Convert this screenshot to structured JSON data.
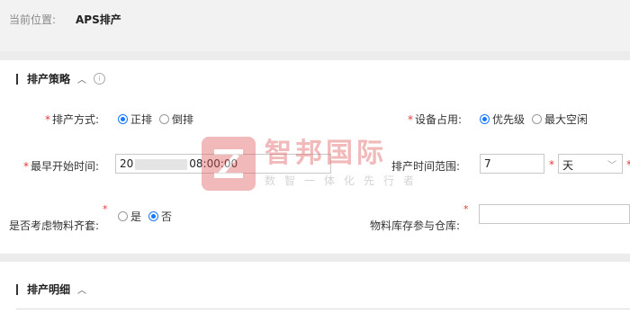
{
  "breadcrumb": {
    "prefix": "当前位置:",
    "current": "APS排产"
  },
  "strategy": {
    "title": "排产策略",
    "method": {
      "label": "排产方式:",
      "options": [
        {
          "label": "正排",
          "selected": true
        },
        {
          "label": "倒排",
          "selected": false
        }
      ]
    },
    "device": {
      "label": "设备占用:",
      "options": [
        {
          "label": "优先级",
          "selected": true
        },
        {
          "label": "最大空闲",
          "selected": false
        }
      ]
    },
    "earliest": {
      "label": "最早开始时间:",
      "value_prefix": "20",
      "value_suffix": "08:00:00"
    },
    "range": {
      "label": "排产时间范围:",
      "value": "7",
      "unit": "天"
    },
    "kitting": {
      "label": "是否考虑物料齐套:",
      "options": [
        {
          "label": "是",
          "selected": false
        },
        {
          "label": "否",
          "selected": true
        }
      ]
    },
    "warehouse": {
      "label": "物料库存参与仓库:",
      "value": ""
    }
  },
  "detail": {
    "title": "排产明细"
  },
  "watermark": {
    "title": "智邦国际",
    "subtitle": "数智一体化先行者"
  }
}
